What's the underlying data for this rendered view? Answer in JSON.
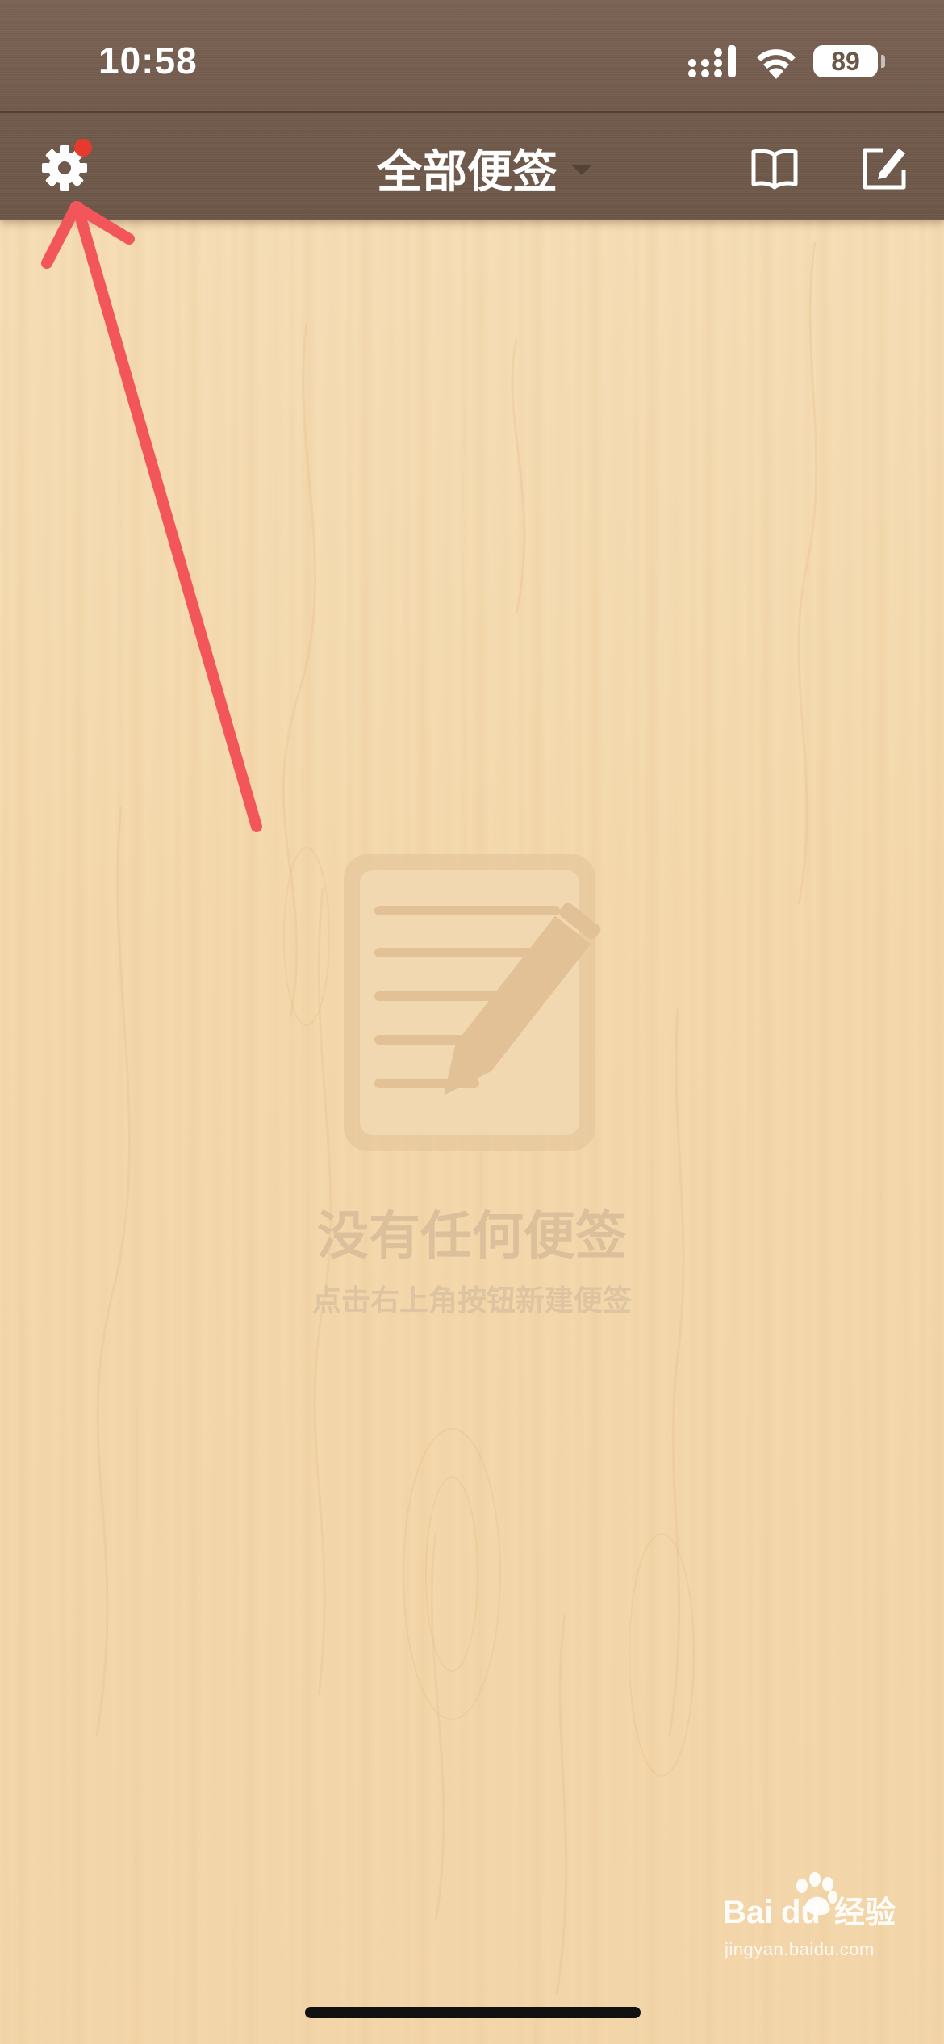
{
  "status_bar": {
    "time": "10:58",
    "battery_level": "89",
    "signal_icon": "signal-bars-icon",
    "wifi_icon": "wifi-icon"
  },
  "nav_bar": {
    "title": "全部便签",
    "settings_icon": "gear-icon",
    "title_dropdown_icon": "chevron-down-icon",
    "book_icon": "book-icon",
    "compose_icon": "compose-icon",
    "has_notification_dot": true
  },
  "empty_state": {
    "icon": "note-pencil-icon",
    "title": "没有任何便签",
    "subtitle": "点击右上角按钮新建便签"
  },
  "annotation": {
    "type": "arrow",
    "points_to": "gear-icon",
    "color": "#f2555a"
  },
  "watermark": {
    "brand": "Baidu经验",
    "url": "jingyan.baidu.com"
  },
  "colors": {
    "toolbar": "#715a4b",
    "wood_background": "#f4d9ad",
    "empty_text": "#dcc09c",
    "notification_dot": "#e63a2e",
    "arrow": "#f2555a"
  }
}
